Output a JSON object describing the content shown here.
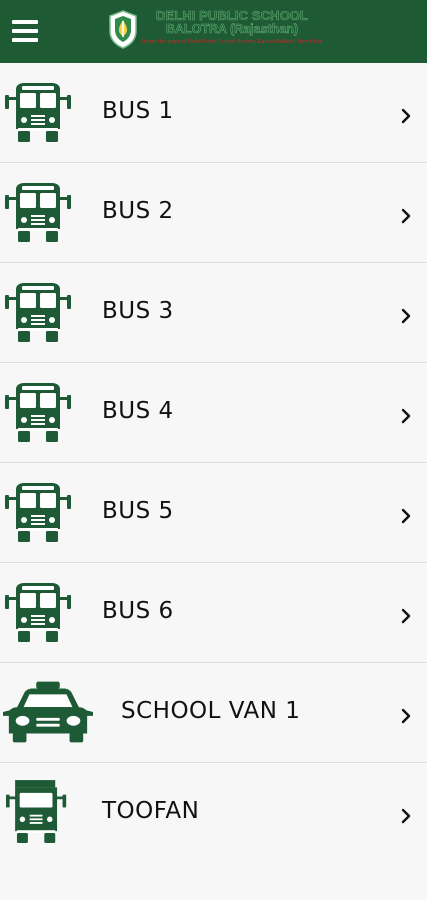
{
  "header": {
    "menu_icon": "hamburger-menu-icon",
    "logo": {
      "emblem_icon": "school-emblem-icon",
      "title": "DELHI PUBLIC SCHOOL",
      "subtitle": "BALOTRA (Rajasthan)",
      "tagline": "Under the aegis of Delhi Public School Society, East of Kailash, New Delhi"
    }
  },
  "colors": {
    "primary": "#1e5a34",
    "icon": "#1f5a36",
    "row_divider": "#dddddd",
    "background": "#f7f7f7"
  },
  "vehicles": [
    {
      "label": "BUS 1",
      "icon": "bus-icon"
    },
    {
      "label": "BUS 2",
      "icon": "bus-icon"
    },
    {
      "label": "BUS 3",
      "icon": "bus-icon"
    },
    {
      "label": "BUS 4",
      "icon": "bus-icon"
    },
    {
      "label": "BUS 5",
      "icon": "bus-icon"
    },
    {
      "label": "BUS 6",
      "icon": "bus-icon"
    },
    {
      "label": "SCHOOL VAN 1",
      "icon": "taxi-icon"
    },
    {
      "label": "TOOFAN",
      "icon": "truck-icon"
    }
  ]
}
